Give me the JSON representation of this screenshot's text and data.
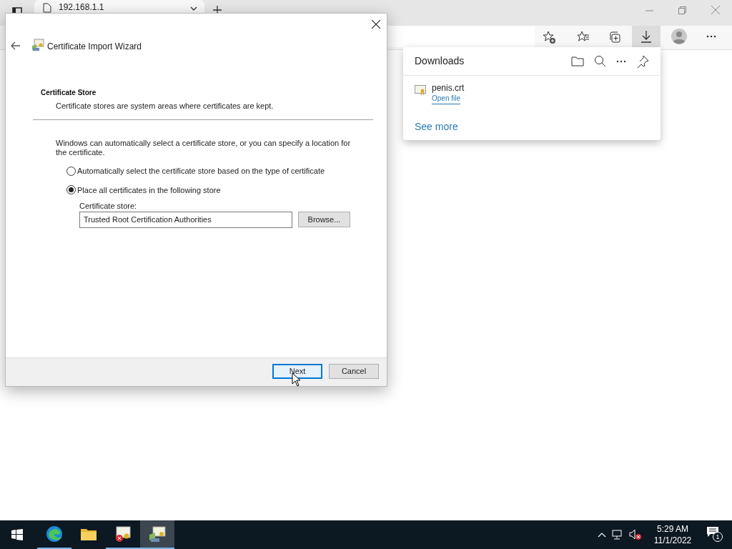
{
  "browser": {
    "tab": {
      "title": "192.168.1.1"
    }
  },
  "downloads": {
    "title": "Downloads",
    "items": [
      {
        "name": "penis.crt",
        "action": "Open file"
      }
    ],
    "see_more": "See more"
  },
  "dialog": {
    "title": "Certificate Import Wizard",
    "section_title": "Certificate Store",
    "section_description": "Certificate stores are system areas where certificates are kept.",
    "intro": "Windows can automatically select a certificate store, or you can specify a location for the certificate.",
    "options": [
      {
        "label": "Automatically select the certificate store based on the type of certificate",
        "selected": false
      },
      {
        "label": "Place all certificates in the following store",
        "selected": true
      }
    ],
    "store_label": "Certificate store:",
    "store_value": "Trusted Root Certification Authorities",
    "browse_button": "Browse...",
    "buttons": [
      {
        "label": "Next",
        "focused": true
      },
      {
        "label": "Cancel",
        "focused": false
      }
    ]
  },
  "taskbar": {
    "apps": [
      {
        "kind": "edge",
        "running": true,
        "active": false
      },
      {
        "kind": "folder",
        "running": false,
        "active": false
      },
      {
        "kind": "certificate-error",
        "running": true,
        "active": false
      },
      {
        "kind": "certificate-wizard",
        "running": true,
        "active": true
      }
    ],
    "time": "5:29 AM",
    "date": "11/1/2022",
    "notifications": "1"
  }
}
